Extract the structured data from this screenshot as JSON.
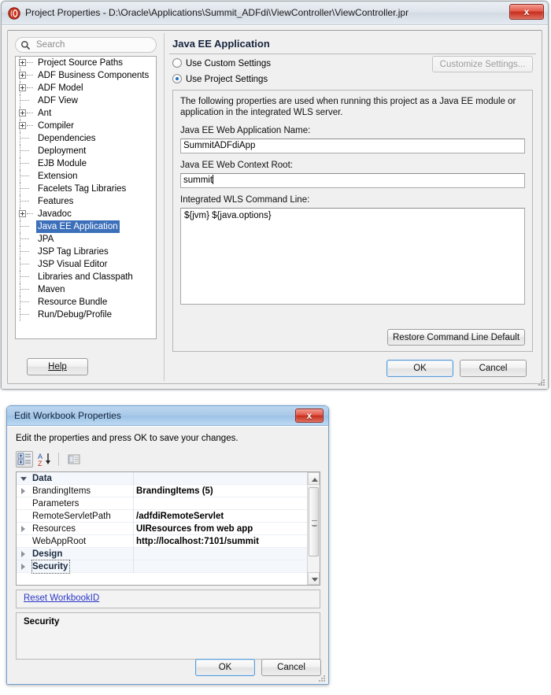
{
  "project_properties": {
    "title": "Project Properties - D:\\Oracle\\Applications\\Summit_ADFdi\\ViewController\\ViewController.jpr",
    "close_label": "x",
    "search": {
      "placeholder": "Search",
      "icon": "search-icon"
    },
    "tree": [
      {
        "label": "Project Source Paths",
        "expandable": true,
        "selected": false
      },
      {
        "label": "ADF Business Components",
        "expandable": true,
        "selected": false
      },
      {
        "label": "ADF Model",
        "expandable": true,
        "selected": false
      },
      {
        "label": "ADF View",
        "expandable": false,
        "selected": false
      },
      {
        "label": "Ant",
        "expandable": true,
        "selected": false
      },
      {
        "label": "Compiler",
        "expandable": true,
        "selected": false
      },
      {
        "label": "Dependencies",
        "expandable": false,
        "selected": false
      },
      {
        "label": "Deployment",
        "expandable": false,
        "selected": false
      },
      {
        "label": "EJB Module",
        "expandable": false,
        "selected": false
      },
      {
        "label": "Extension",
        "expandable": false,
        "selected": false
      },
      {
        "label": "Facelets Tag Libraries",
        "expandable": false,
        "selected": false
      },
      {
        "label": "Features",
        "expandable": false,
        "selected": false
      },
      {
        "label": "Javadoc",
        "expandable": true,
        "selected": false
      },
      {
        "label": "Java EE Application",
        "expandable": false,
        "selected": true
      },
      {
        "label": "JPA",
        "expandable": false,
        "selected": false
      },
      {
        "label": "JSP Tag Libraries",
        "expandable": false,
        "selected": false
      },
      {
        "label": "JSP Visual Editor",
        "expandable": false,
        "selected": false
      },
      {
        "label": "Libraries and Classpath",
        "expandable": false,
        "selected": false
      },
      {
        "label": "Maven",
        "expandable": false,
        "selected": false
      },
      {
        "label": "Resource Bundle",
        "expandable": false,
        "selected": false
      },
      {
        "label": "Run/Debug/Profile",
        "expandable": false,
        "selected": false
      }
    ],
    "help_label": "Help",
    "pane": {
      "title": "Java EE Application",
      "radio_custom": "Use Custom Settings",
      "radio_project": "Use Project Settings",
      "selected_radio": "project",
      "customize_label": "Customize Settings...",
      "customize_enabled": false,
      "description": "The following properties are used when running this project as a Java EE module or application in the integrated WLS server.",
      "app_name_label": "Java EE Web Application Name:",
      "app_name_value": "SummitADFdiApp",
      "context_root_label": "Java EE Web Context Root:",
      "context_root_value": "summit",
      "command_line_label": "Integrated WLS Command Line:",
      "command_line_value": "${jvm} ${java.options}",
      "restore_label": "Restore Command Line Default"
    },
    "ok_label": "OK",
    "cancel_label": "Cancel"
  },
  "workbook_properties": {
    "title": "Edit Workbook Properties",
    "close_label": "x",
    "instruction": "Edit the properties and press OK to save your changes.",
    "toolbar": [
      {
        "name": "categorized-icon",
        "pressed": true
      },
      {
        "name": "alphabetical-sort-icon",
        "pressed": false
      },
      {
        "name": "property-pages-icon",
        "pressed": false
      }
    ],
    "grid": [
      {
        "kind": "category",
        "name": "Data",
        "value": "",
        "twisty": "open",
        "focus": false
      },
      {
        "kind": "property",
        "name": "BrandingItems",
        "value": "BrandingItems (5)",
        "twisty": "closed",
        "focus": false
      },
      {
        "kind": "property",
        "name": "Parameters",
        "value": "",
        "twisty": "none",
        "focus": false
      },
      {
        "kind": "property",
        "name": "RemoteServletPath",
        "value": "/adfdiRemoteServlet",
        "twisty": "none",
        "focus": false
      },
      {
        "kind": "property",
        "name": "Resources",
        "value": "UIResources from web app",
        "twisty": "closed",
        "focus": false
      },
      {
        "kind": "property",
        "name": "WebAppRoot",
        "value": "http://localhost:7101/summit",
        "twisty": "none",
        "focus": false
      },
      {
        "kind": "category",
        "name": "Design",
        "value": "",
        "twisty": "closed",
        "focus": false
      },
      {
        "kind": "category",
        "name": "Security",
        "value": "",
        "twisty": "closed",
        "focus": true
      }
    ],
    "reset_link": "Reset WorkbookID",
    "description_title": "Security",
    "description_body": "",
    "ok_label": "OK",
    "cancel_label": "Cancel"
  },
  "colors": {
    "selection_blue": "#3c6fba",
    "link_blue": "#2b37c8",
    "title_blue": "#a8c9e8",
    "close_red": "#c62e1d",
    "dialog_bg": "#f0f0f0"
  }
}
